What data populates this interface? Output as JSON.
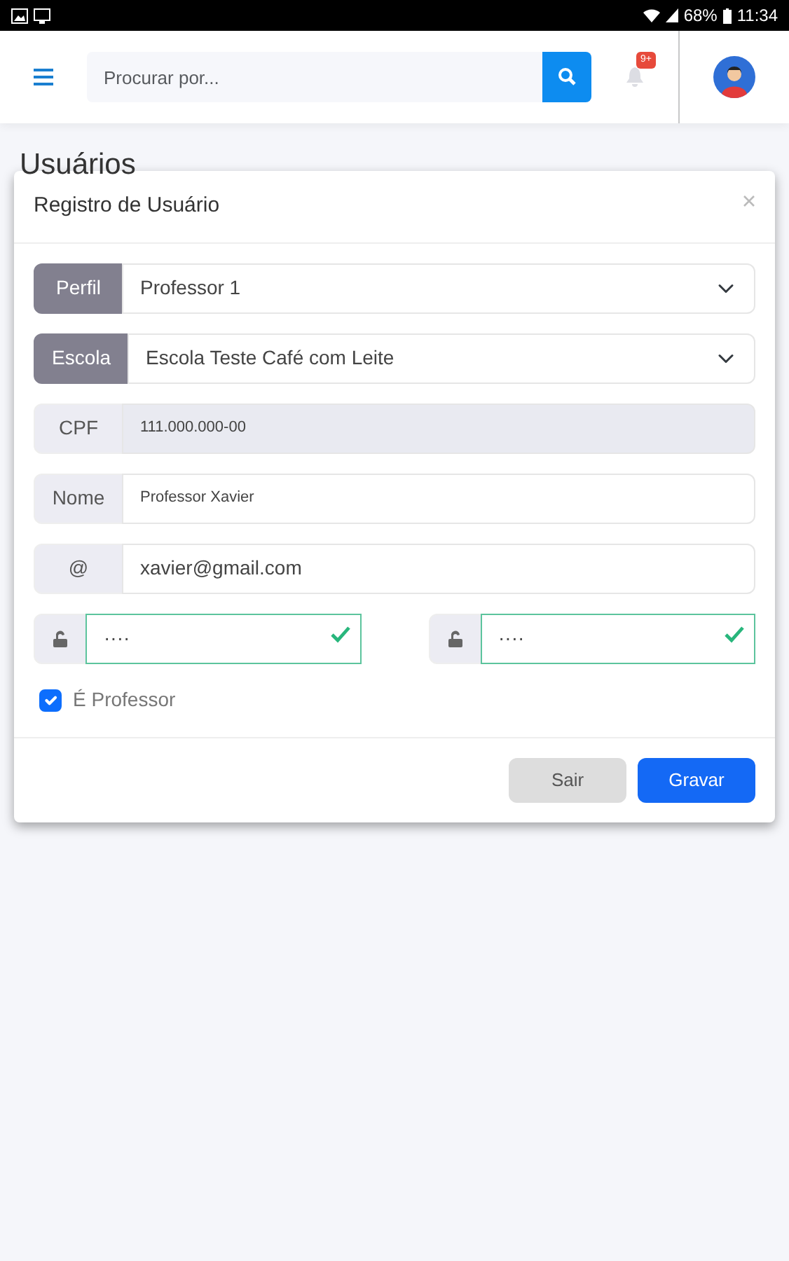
{
  "status_bar": {
    "battery": "68%",
    "time": "11:34"
  },
  "header": {
    "search": {
      "placeholder": "Procurar por..."
    },
    "notifications": {
      "badge": "9+"
    }
  },
  "page": {
    "title": "Usuários"
  },
  "modal": {
    "title": "Registro de Usuário",
    "fields": [
      {
        "kind": "select",
        "label": "Perfil",
        "value": "Professor 1",
        "disabled": false
      },
      {
        "kind": "select",
        "label": "Escola",
        "value": "Escola Teste Café com Leite",
        "disabled": false
      },
      {
        "kind": "text",
        "label": "CPF",
        "value": "111.000.000-00",
        "disabled": true
      },
      {
        "kind": "text",
        "label": "Nome",
        "value": "Professor Xavier",
        "disabled": false
      },
      {
        "kind": "email",
        "label": "@",
        "value": "xavier@gmail.com",
        "disabled": false
      }
    ],
    "passwords": [
      {
        "value": "····",
        "valid": true
      },
      {
        "value": "····",
        "valid": true
      }
    ],
    "checkbox": {
      "label": "É Professor",
      "checked": true
    },
    "buttons": [
      {
        "label": "Sair",
        "kind": "secondary"
      },
      {
        "label": "Gravar",
        "kind": "primary"
      }
    ]
  }
}
